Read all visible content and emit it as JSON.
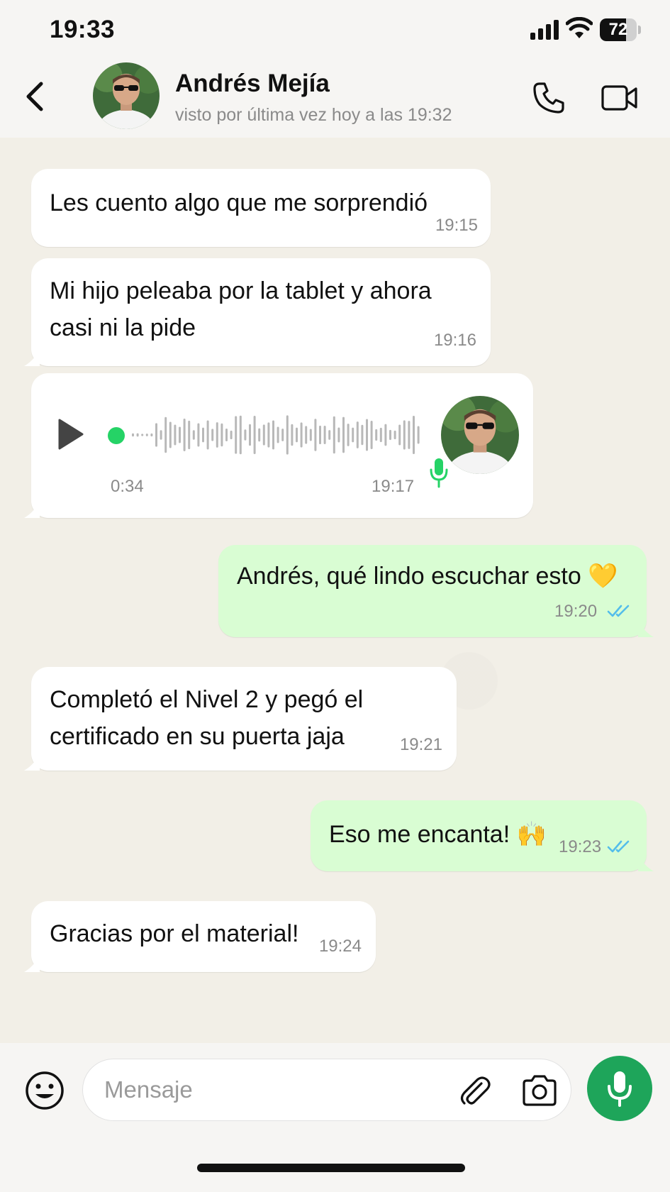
{
  "status_bar": {
    "time": "19:33",
    "battery": "72",
    "battery_level": 0.72
  },
  "header": {
    "contact_name": "Andrés Mejía",
    "last_seen": "visto por última vez hoy a las 19:32",
    "icons": {
      "back": "chevron-left-icon",
      "call": "phone-icon",
      "video": "video-camera-icon"
    }
  },
  "messages": [
    {
      "direction": "in",
      "text": "Les cuento algo que me sorprendió",
      "time": "19:15"
    },
    {
      "direction": "in",
      "text": "Mi hijo peleaba por la tablet y ahora\ncasi ni la pide",
      "time": "19:16"
    },
    {
      "direction": "in",
      "type": "voice",
      "duration": "0:34",
      "time": "19:17",
      "progress": 0.0
    },
    {
      "direction": "out",
      "text": "Andrés, qué lindo escuchar esto 💛",
      "time": "19:20",
      "status": "read"
    },
    {
      "direction": "in",
      "text": "Completó el Nivel 2 y pegó el\ncertificado en su puerta jaja",
      "time": "19:21"
    },
    {
      "direction": "out",
      "text": "Eso me encanta! 🙌",
      "time": "19:23",
      "status": "read"
    },
    {
      "direction": "in",
      "text": "Gracias por el material!",
      "time": "19:24"
    }
  ],
  "composer": {
    "placeholder": "Mensaje",
    "icons": {
      "emoji": "smiley-icon",
      "attach": "paperclip-icon",
      "camera": "camera-icon",
      "mic": "microphone-icon"
    }
  },
  "colors": {
    "incoming_bubble": "#ffffff",
    "outgoing_bubble": "#d9fdd3",
    "accent_green": "#1ea55a",
    "read_ticks": "#53bdeb"
  }
}
